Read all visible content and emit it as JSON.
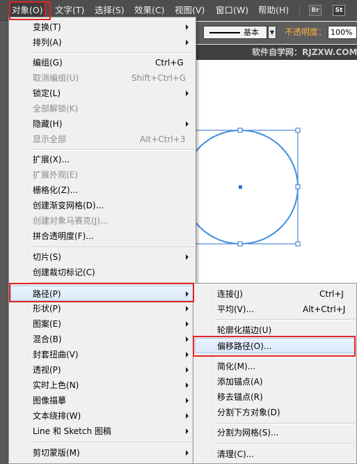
{
  "menubar": {
    "items": [
      {
        "label": "对象(O)",
        "active": true
      },
      {
        "label": "文字(T)"
      },
      {
        "label": "选择(S)"
      },
      {
        "label": "效果(C)"
      },
      {
        "label": "视图(V)"
      },
      {
        "label": "窗口(W)"
      },
      {
        "label": "帮助(H)"
      }
    ],
    "apps": [
      "Br",
      "St"
    ]
  },
  "controlbar": {
    "stroke_profile": "基本",
    "opacity_label": "不透明度：",
    "opacity_value": "100%",
    "opacity_color": "#ffb23a"
  },
  "tabstrip": {
    "doc_prefix": "@",
    "watermark": "软件自学网：RJZXW.COM"
  },
  "canvas": {
    "shape": "circle",
    "stroke_color": "#3a8fdf",
    "selection_color": "#2a6fd6"
  },
  "object_menu": {
    "items": [
      {
        "label": "变换(T)",
        "submenu": true
      },
      {
        "label": "排列(A)",
        "submenu": true
      },
      {
        "sep": true
      },
      {
        "label": "编组(G)",
        "shortcut": "Ctrl+G"
      },
      {
        "label": "取消编组(U)",
        "shortcut": "Shift+Ctrl+G",
        "disabled": true
      },
      {
        "label": "锁定(L)",
        "submenu": true
      },
      {
        "label": "全部解锁(K)",
        "disabled": true
      },
      {
        "label": "隐藏(H)",
        "submenu": true
      },
      {
        "label": "显示全部",
        "shortcut": "Alt+Ctrl+3",
        "disabled": true
      },
      {
        "sep": true
      },
      {
        "label": "扩展(X)..."
      },
      {
        "label": "扩展外观(E)",
        "disabled": true
      },
      {
        "label": "栅格化(Z)..."
      },
      {
        "label": "创建渐变网格(D)..."
      },
      {
        "label": "创建对象马赛克(J)...",
        "disabled": true
      },
      {
        "label": "拼合透明度(F)..."
      },
      {
        "sep": true
      },
      {
        "label": "切片(S)",
        "submenu": true
      },
      {
        "label": "创建裁切标记(C)"
      },
      {
        "sep": true
      },
      {
        "label": "路径(P)",
        "submenu": true,
        "highlight": true
      },
      {
        "label": "形状(P)",
        "submenu": true
      },
      {
        "label": "图案(E)",
        "submenu": true
      },
      {
        "label": "混合(B)",
        "submenu": true
      },
      {
        "label": "封套扭曲(V)",
        "submenu": true
      },
      {
        "label": "透视(P)",
        "submenu": true
      },
      {
        "label": "实时上色(N)",
        "submenu": true
      },
      {
        "label": "图像描摹",
        "submenu": true
      },
      {
        "label": "文本绕排(W)",
        "submenu": true
      },
      {
        "label": "Line 和 Sketch 图稿",
        "submenu": true
      },
      {
        "sep": true
      },
      {
        "label": "剪切蒙版(M)",
        "submenu": true
      }
    ]
  },
  "path_submenu": {
    "items": [
      {
        "label": "连接(J)",
        "shortcut": "Ctrl+J"
      },
      {
        "label": "平均(V)...",
        "shortcut": "Alt+Ctrl+J"
      },
      {
        "sep": true
      },
      {
        "label": "轮廓化描边(U)"
      },
      {
        "label": "偏移路径(O)...",
        "highlight": true
      },
      {
        "sep": true
      },
      {
        "label": "简化(M)..."
      },
      {
        "label": "添加锚点(A)"
      },
      {
        "label": "移去锚点(R)"
      },
      {
        "label": "分割下方对象(D)"
      },
      {
        "sep": true
      },
      {
        "label": "分割为网格(S)..."
      },
      {
        "sep": true
      },
      {
        "label": "清理(C)..."
      }
    ]
  }
}
